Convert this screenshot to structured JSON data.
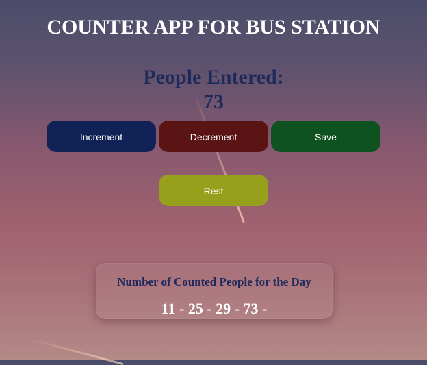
{
  "app": {
    "title": "COUNTER APP FOR BUS STATION"
  },
  "counter": {
    "label": "People Entered:",
    "count": "73"
  },
  "buttons": {
    "increment": "Increment",
    "decrement": "Decrement",
    "save": "Save",
    "rest": "Rest"
  },
  "summary": {
    "title": "Number of Counted People for the Day",
    "entries": "11 - 25 - 29 - 73 -"
  },
  "colors": {
    "increment": "#112356",
    "decrement": "#5a1414",
    "save": "#0f5221",
    "rest": "#97a01c",
    "heading_text": "#1e2a5a"
  }
}
